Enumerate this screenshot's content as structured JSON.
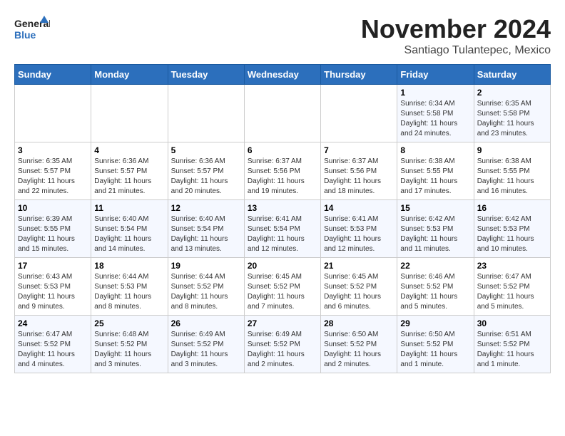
{
  "header": {
    "logo_line1": "General",
    "logo_line2": "Blue",
    "month": "November 2024",
    "location": "Santiago Tulantepec, Mexico"
  },
  "weekdays": [
    "Sunday",
    "Monday",
    "Tuesday",
    "Wednesday",
    "Thursday",
    "Friday",
    "Saturday"
  ],
  "weeks": [
    [
      {
        "day": "",
        "info": ""
      },
      {
        "day": "",
        "info": ""
      },
      {
        "day": "",
        "info": ""
      },
      {
        "day": "",
        "info": ""
      },
      {
        "day": "",
        "info": ""
      },
      {
        "day": "1",
        "info": "Sunrise: 6:34 AM\nSunset: 5:58 PM\nDaylight: 11 hours and 24 minutes."
      },
      {
        "day": "2",
        "info": "Sunrise: 6:35 AM\nSunset: 5:58 PM\nDaylight: 11 hours and 23 minutes."
      }
    ],
    [
      {
        "day": "3",
        "info": "Sunrise: 6:35 AM\nSunset: 5:57 PM\nDaylight: 11 hours and 22 minutes."
      },
      {
        "day": "4",
        "info": "Sunrise: 6:36 AM\nSunset: 5:57 PM\nDaylight: 11 hours and 21 minutes."
      },
      {
        "day": "5",
        "info": "Sunrise: 6:36 AM\nSunset: 5:57 PM\nDaylight: 11 hours and 20 minutes."
      },
      {
        "day": "6",
        "info": "Sunrise: 6:37 AM\nSunset: 5:56 PM\nDaylight: 11 hours and 19 minutes."
      },
      {
        "day": "7",
        "info": "Sunrise: 6:37 AM\nSunset: 5:56 PM\nDaylight: 11 hours and 18 minutes."
      },
      {
        "day": "8",
        "info": "Sunrise: 6:38 AM\nSunset: 5:55 PM\nDaylight: 11 hours and 17 minutes."
      },
      {
        "day": "9",
        "info": "Sunrise: 6:38 AM\nSunset: 5:55 PM\nDaylight: 11 hours and 16 minutes."
      }
    ],
    [
      {
        "day": "10",
        "info": "Sunrise: 6:39 AM\nSunset: 5:55 PM\nDaylight: 11 hours and 15 minutes."
      },
      {
        "day": "11",
        "info": "Sunrise: 6:40 AM\nSunset: 5:54 PM\nDaylight: 11 hours and 14 minutes."
      },
      {
        "day": "12",
        "info": "Sunrise: 6:40 AM\nSunset: 5:54 PM\nDaylight: 11 hours and 13 minutes."
      },
      {
        "day": "13",
        "info": "Sunrise: 6:41 AM\nSunset: 5:54 PM\nDaylight: 11 hours and 12 minutes."
      },
      {
        "day": "14",
        "info": "Sunrise: 6:41 AM\nSunset: 5:53 PM\nDaylight: 11 hours and 12 minutes."
      },
      {
        "day": "15",
        "info": "Sunrise: 6:42 AM\nSunset: 5:53 PM\nDaylight: 11 hours and 11 minutes."
      },
      {
        "day": "16",
        "info": "Sunrise: 6:42 AM\nSunset: 5:53 PM\nDaylight: 11 hours and 10 minutes."
      }
    ],
    [
      {
        "day": "17",
        "info": "Sunrise: 6:43 AM\nSunset: 5:53 PM\nDaylight: 11 hours and 9 minutes."
      },
      {
        "day": "18",
        "info": "Sunrise: 6:44 AM\nSunset: 5:53 PM\nDaylight: 11 hours and 8 minutes."
      },
      {
        "day": "19",
        "info": "Sunrise: 6:44 AM\nSunset: 5:52 PM\nDaylight: 11 hours and 8 minutes."
      },
      {
        "day": "20",
        "info": "Sunrise: 6:45 AM\nSunset: 5:52 PM\nDaylight: 11 hours and 7 minutes."
      },
      {
        "day": "21",
        "info": "Sunrise: 6:45 AM\nSunset: 5:52 PM\nDaylight: 11 hours and 6 minutes."
      },
      {
        "day": "22",
        "info": "Sunrise: 6:46 AM\nSunset: 5:52 PM\nDaylight: 11 hours and 5 minutes."
      },
      {
        "day": "23",
        "info": "Sunrise: 6:47 AM\nSunset: 5:52 PM\nDaylight: 11 hours and 5 minutes."
      }
    ],
    [
      {
        "day": "24",
        "info": "Sunrise: 6:47 AM\nSunset: 5:52 PM\nDaylight: 11 hours and 4 minutes."
      },
      {
        "day": "25",
        "info": "Sunrise: 6:48 AM\nSunset: 5:52 PM\nDaylight: 11 hours and 3 minutes."
      },
      {
        "day": "26",
        "info": "Sunrise: 6:49 AM\nSunset: 5:52 PM\nDaylight: 11 hours and 3 minutes."
      },
      {
        "day": "27",
        "info": "Sunrise: 6:49 AM\nSunset: 5:52 PM\nDaylight: 11 hours and 2 minutes."
      },
      {
        "day": "28",
        "info": "Sunrise: 6:50 AM\nSunset: 5:52 PM\nDaylight: 11 hours and 2 minutes."
      },
      {
        "day": "29",
        "info": "Sunrise: 6:50 AM\nSunset: 5:52 PM\nDaylight: 11 hours and 1 minute."
      },
      {
        "day": "30",
        "info": "Sunrise: 6:51 AM\nSunset: 5:52 PM\nDaylight: 11 hours and 1 minute."
      }
    ]
  ]
}
